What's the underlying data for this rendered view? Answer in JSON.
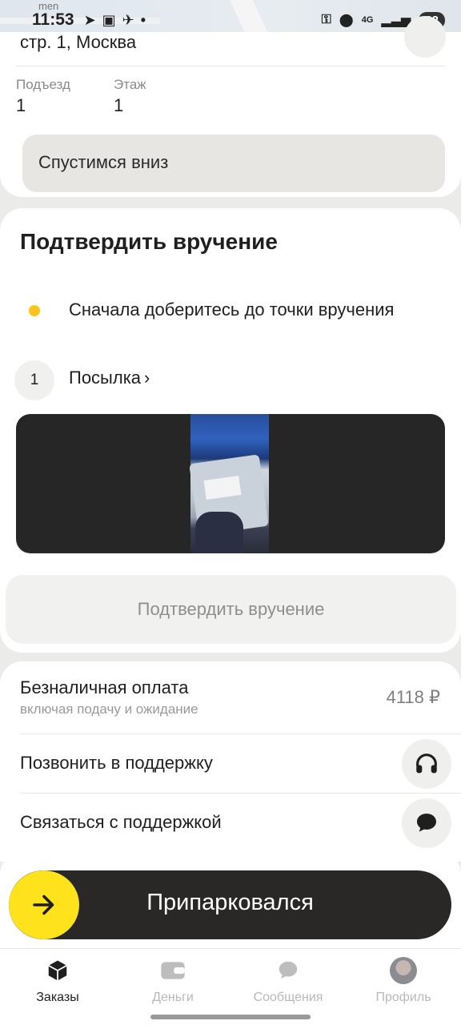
{
  "status_bar": {
    "time": "11:53",
    "battery": "82",
    "network": "4G",
    "map_text": "men"
  },
  "address": {
    "line": "стр. 1, Москва",
    "entrance_label": "Подъезд",
    "entrance_value": "1",
    "floor_label": "Этаж",
    "floor_value": "1",
    "comment": "Спустимся вниз"
  },
  "delivery": {
    "title": "Подтвердить вручение",
    "step_text": "Сначала доберитесь до точки вручения",
    "parcel_count": "1",
    "parcel_label": "Посылка",
    "confirm_button": "Подтвердить вручение"
  },
  "payment": {
    "title": "Безналичная оплата",
    "subtitle": "включая подачу и ожидание",
    "amount": "4118 ₽"
  },
  "support": {
    "call_label": "Позвонить в поддержку",
    "chat_label": "Связаться с поддержкой"
  },
  "park": {
    "label": "Припарковался"
  },
  "nav": {
    "items": [
      {
        "label": "Заказы",
        "icon": "box-icon",
        "active": true
      },
      {
        "label": "Деньги",
        "icon": "wallet-icon",
        "active": false
      },
      {
        "label": "Сообщения",
        "icon": "chat-icon",
        "active": false
      },
      {
        "label": "Профиль",
        "icon": "avatar",
        "active": false
      }
    ]
  },
  "colors": {
    "accent_yellow": "#fde21c",
    "dot_yellow": "#fcc419",
    "dark": "#2a2826"
  }
}
